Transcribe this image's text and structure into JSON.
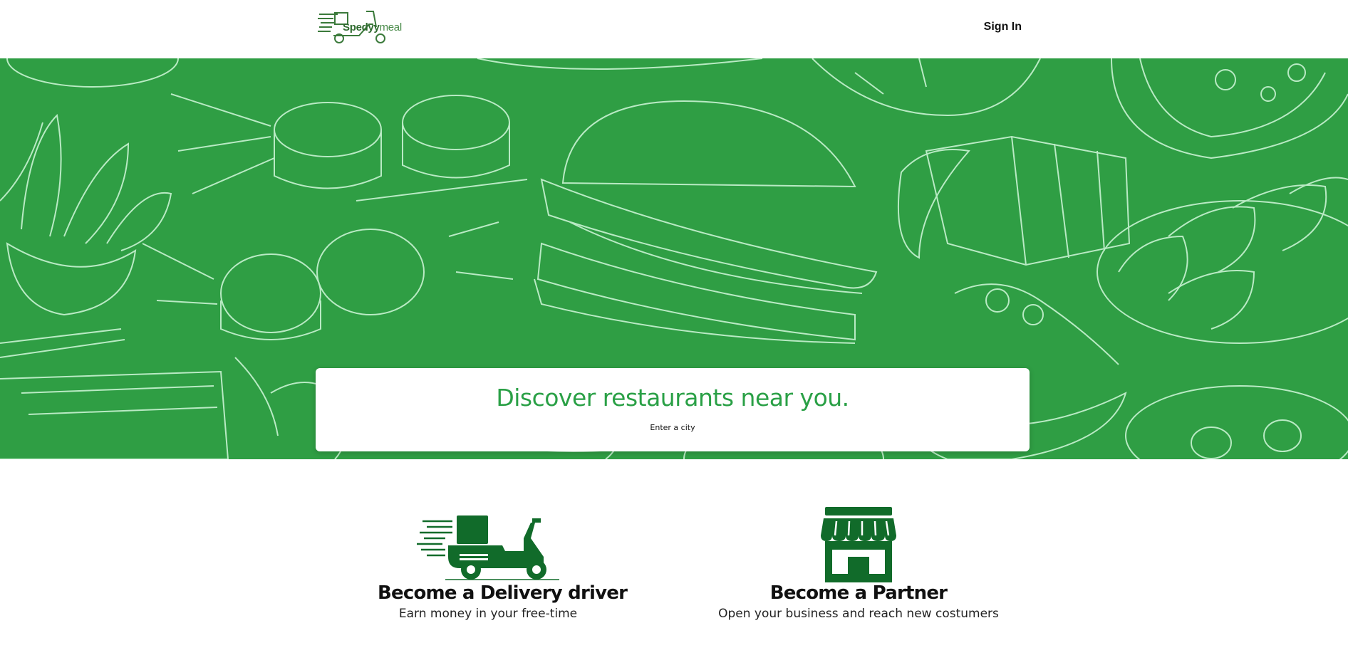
{
  "header": {
    "logo": {
      "primary": "Spedyy",
      "suffix": "meal",
      "icon": "scooter-logo-icon"
    },
    "sign_in_label": "Sign In"
  },
  "hero": {
    "heading": "Discover restaurants near you.",
    "city_placeholder": "Enter a city",
    "city_value": "",
    "background_color": "#2f9e44"
  },
  "features": [
    {
      "title": "Become a Delivery driver",
      "subtitle": "Earn money in your free-time",
      "icon": "delivery-scooter-icon"
    },
    {
      "title": "Become a Partner",
      "subtitle": "Open your business and reach new costumers",
      "icon": "storefront-icon"
    }
  ],
  "colors": {
    "brand_green": "#2aa046",
    "icon_green": "#116b2a"
  }
}
